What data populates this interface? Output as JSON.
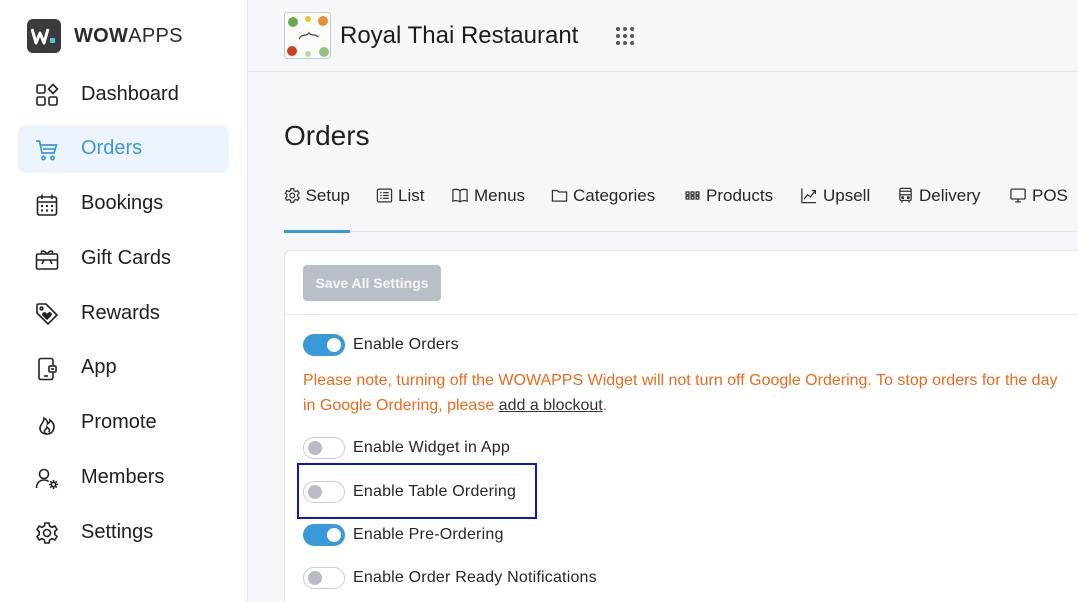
{
  "brand": {
    "name_bold": "WOW",
    "name_rest": "APPS",
    "mark": "W"
  },
  "sidebar": {
    "items": [
      {
        "label": "Dashboard",
        "icon": "dashboard-icon",
        "active": false
      },
      {
        "label": "Orders",
        "icon": "cart-icon",
        "active": true
      },
      {
        "label": "Bookings",
        "icon": "calendar-icon",
        "active": false
      },
      {
        "label": "Gift Cards",
        "icon": "gift-card-icon",
        "active": false
      },
      {
        "label": "Rewards",
        "icon": "tag-heart-icon",
        "active": false
      },
      {
        "label": "App",
        "icon": "phone-icon",
        "active": false
      },
      {
        "label": "Promote",
        "icon": "flame-icon",
        "active": false
      },
      {
        "label": "Members",
        "icon": "members-icon",
        "active": false
      },
      {
        "label": "Settings",
        "icon": "gear-icon",
        "active": false
      }
    ]
  },
  "header": {
    "restaurant_name": "Royal Thai Restaurant"
  },
  "main": {
    "title": "Orders",
    "tabs": [
      {
        "label": "Setup",
        "icon": "gear-icon",
        "active": true
      },
      {
        "label": "List",
        "icon": "list-icon"
      },
      {
        "label": "Menus",
        "icon": "book-icon"
      },
      {
        "label": "Categories",
        "icon": "folder-icon"
      },
      {
        "label": "Products",
        "icon": "grid-icon"
      },
      {
        "label": "Upsell",
        "icon": "chart-line-icon"
      },
      {
        "label": "Delivery",
        "icon": "bus-icon"
      },
      {
        "label": "POS",
        "icon": "monitor-icon"
      }
    ],
    "save_label": "Save All Settings",
    "toggles": {
      "enable_orders": {
        "label": "Enable Orders",
        "on": true
      },
      "enable_widget": {
        "label": "Enable Widget in App",
        "on": false
      },
      "enable_table": {
        "label": "Enable Table Ordering",
        "on": false
      },
      "enable_preorder": {
        "label": "Enable Pre-Ordering",
        "on": true
      },
      "enable_ready": {
        "label": "Enable Order Ready Notifications",
        "on": false
      }
    },
    "note": {
      "text": "Please note, turning off the WOWAPPS Widget will not turn off Google Ordering. To stop orders for the day in Google Ordering, please ",
      "link": "add a blockout",
      "end": "."
    }
  },
  "colors": {
    "accent": "#3a9ad9",
    "warning": "#ed6a1c",
    "highlight": "#0a16d6"
  }
}
